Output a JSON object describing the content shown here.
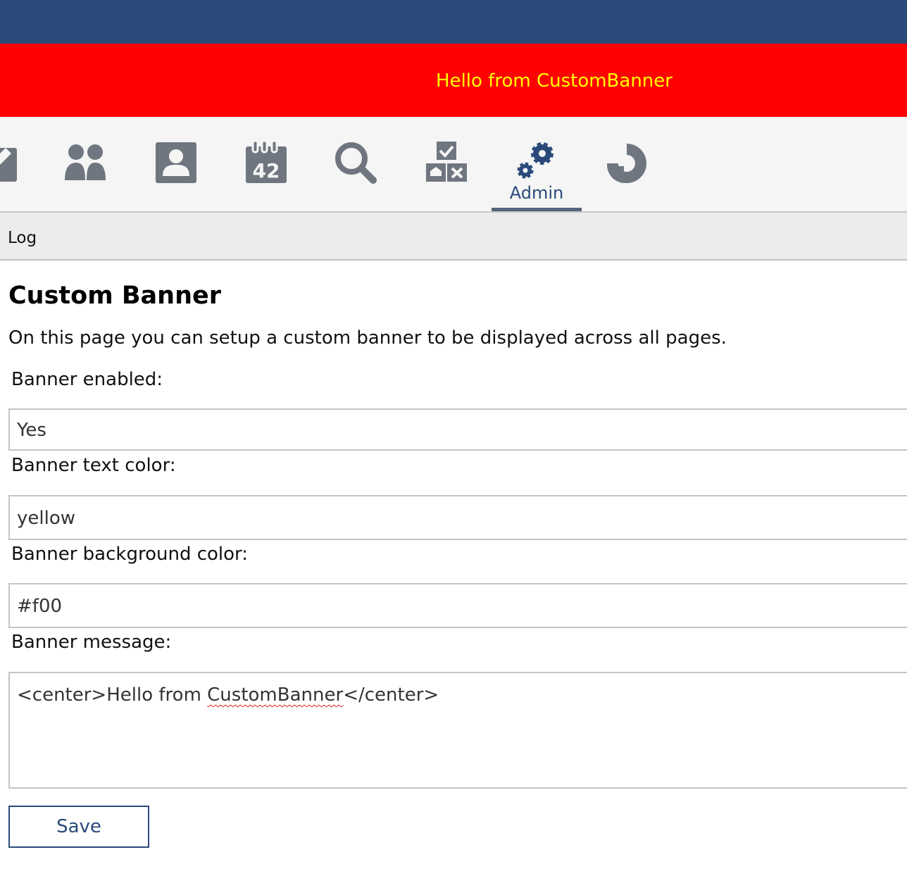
{
  "colors": {
    "topbar": "#2a4a7a",
    "banner_background": "#ff0000",
    "banner_text": "#ffff00",
    "accent": "#2a4a7a",
    "icon": "#6f7680"
  },
  "banner": {
    "message": "Hello from CustomBanner"
  },
  "nav": {
    "items": [
      {
        "icon": "edit-icon"
      },
      {
        "icon": "users-icon"
      },
      {
        "icon": "user-icon"
      },
      {
        "icon": "calendar-42-icon"
      },
      {
        "icon": "search-icon"
      },
      {
        "icon": "tasks-icon"
      },
      {
        "icon": "admin-gears-icon",
        "label": "Admin",
        "active": true
      },
      {
        "icon": "help-icon"
      }
    ]
  },
  "subnav": {
    "log_label": "Log"
  },
  "page": {
    "title": "Custom Banner",
    "description": "On this page you can setup a custom banner to be displayed across all pages."
  },
  "form": {
    "enabled_label": "Banner enabled:",
    "enabled_value": "Yes",
    "text_color_label": "Banner text color:",
    "text_color_value": "yellow",
    "bg_color_label": "Banner background color:",
    "bg_color_value": "#f00",
    "message_label": "Banner message:",
    "message_before": "<center>Hello from ",
    "message_misspelled": "CustomBanner",
    "message_after": "</center>",
    "save_label": "Save"
  }
}
